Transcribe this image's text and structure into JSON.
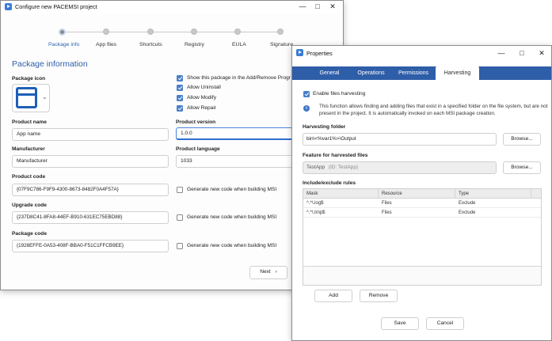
{
  "main": {
    "title": "Configure new PACEMSI project",
    "steps": [
      "Package info",
      "App files",
      "Shortcuts",
      "Registry",
      "EULA",
      "Signature"
    ],
    "section_title": "Package information",
    "package_icon_label": "Package icon",
    "checkboxes": [
      {
        "label": "Show this package in the Add/Remove Progr",
        "checked": true
      },
      {
        "label": "Allow Uninstall",
        "checked": true
      },
      {
        "label": "Allow Modify",
        "checked": true
      },
      {
        "label": "Allow Repair",
        "checked": true
      }
    ],
    "product_name_label": "Product name",
    "product_name_value": "App name",
    "product_version_label": "Product version",
    "product_version_value": "1.0.0",
    "manufacturer_label": "Manufacturer",
    "manufacturer_value": "Manufacturer",
    "product_language_label": "Product language",
    "product_language_value": "1033",
    "product_code_label": "Product code",
    "product_code_value": "{07F9C786-F9F9-4300-8673-8482F0A4F57A}",
    "upgrade_code_label": "Upgrade code",
    "upgrade_code_value": "{237D8C41-8FA8-44EF-B910-631EC75EBD88}",
    "package_code_label": "Package code",
    "package_code_value": "{1928EFFE-0A53-408F-BBA0-F51C1FFCB9EE}",
    "generate_label": "Generate new code when building MSI",
    "next_label": "Next",
    "next_icon": "chevron-right-icon"
  },
  "props": {
    "title": "Properties",
    "tabs": [
      "General",
      "Operations",
      "Permissions",
      "Harvesting"
    ],
    "active_tab": "Harvesting",
    "enable_label": "Enable files harvesting",
    "info_text": "This function allows finding and adding files that exist in a specified folder on the file system, but are not present in the project. It is automatically invoked on each MSI package creation.",
    "harvest_folder_label": "Harvesting folder",
    "harvest_folder_value": "bin\\<%var1%>\\Output",
    "browse_label": "Browse...",
    "feature_label": "Feature for harvested files",
    "feature_value": "TestApp",
    "feature_id": "(ID: TestApp)",
    "rules_label": "Include/exclude rules",
    "columns": [
      "Mask",
      "Resource",
      "Type"
    ],
    "rows": [
      {
        "mask": "^.*\\.log$",
        "resource": "Files",
        "type": "Exclude"
      },
      {
        "mask": "^.*\\.tmp$",
        "resource": "Files",
        "type": "Exclude"
      }
    ],
    "add_label": "Add",
    "remove_label": "Remove",
    "save_label": "Save",
    "cancel_label": "Cancel"
  },
  "colors": {
    "accent": "#2f5ea8",
    "title_blue": "#2e5ea8"
  }
}
